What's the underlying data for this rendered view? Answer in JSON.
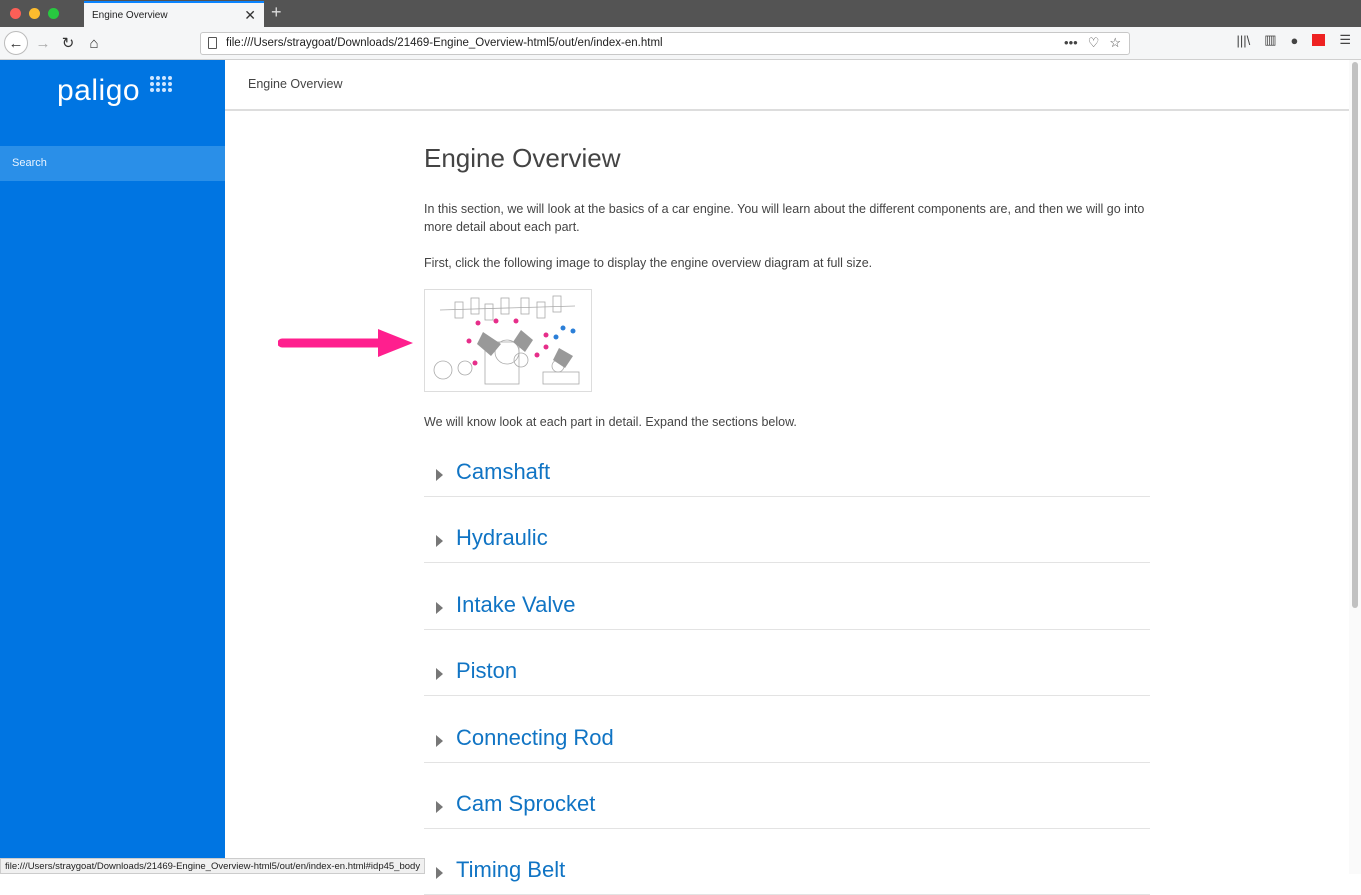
{
  "browser": {
    "tab_title": "Engine Overview",
    "url": "file:///Users/straygoat/Downloads/21469-Engine_Overview-html5/out/en/index-en.html",
    "status_url": "file:///Users/straygoat/Downloads/21469-Engine_Overview-html5/out/en/index-en.html#idp45_body"
  },
  "sidebar": {
    "logo": "paligo",
    "search_label": "Search"
  },
  "header": {
    "title": "Engine Overview"
  },
  "content": {
    "title": "Engine Overview",
    "intro": "In this section, we will look at the basics of a car engine. You will learn about the different components are, and then we will go into more detail about each part.",
    "instruction": "First, click the following image to display the engine overview diagram at full size.",
    "after_image": "We will know look at each part in detail. Expand the sections below.",
    "sections": [
      "Camshaft",
      "Hydraulic",
      "Intake Valve",
      "Piston",
      "Connecting Rod",
      "Cam Sprocket",
      "Timing Belt"
    ]
  },
  "colors": {
    "brand": "#0075e2",
    "link": "#1074c4",
    "arrow": "#ff1f8e"
  }
}
